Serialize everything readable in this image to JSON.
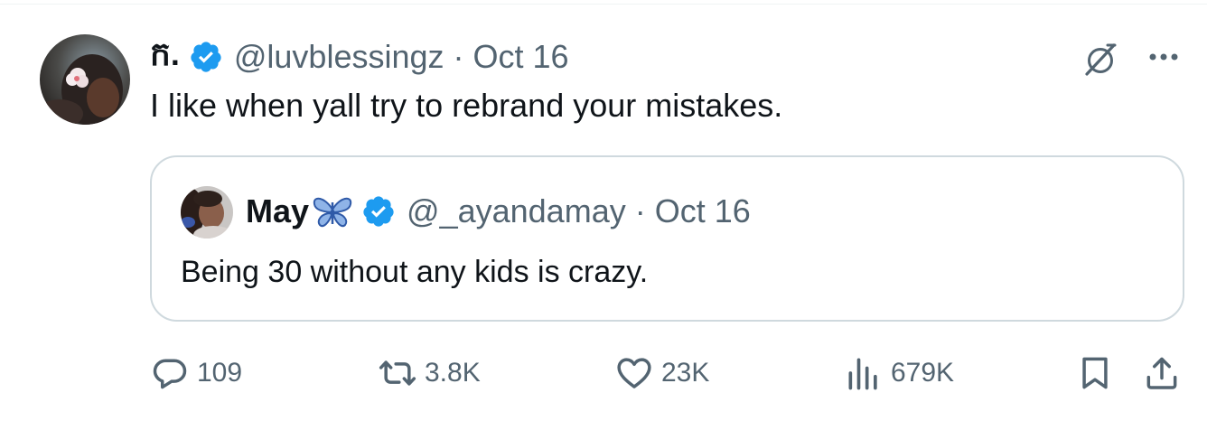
{
  "tweet": {
    "author_name": "ក.",
    "handle": "@luvblessingz",
    "separator": "·",
    "date": "Oct 16",
    "text": "I like when yall try to rebrand your mistakes."
  },
  "quoted": {
    "author_name": "May",
    "handle": "@_ayandamay",
    "separator": "·",
    "date": "Oct 16",
    "text": "Being 30 without any kids is crazy."
  },
  "actions": {
    "replies": "109",
    "reposts": "3.8K",
    "likes": "23K",
    "views": "679K"
  },
  "icons": {
    "verified": "verified-badge-icon",
    "grok": "grok-icon",
    "more": "more-icon",
    "reply": "reply-icon",
    "repost": "repost-icon",
    "like": "heart-icon",
    "views": "views-icon",
    "bookmark": "bookmark-icon",
    "share": "share-icon",
    "butterfly": "butterfly-icon"
  },
  "colors": {
    "text_primary": "#0f1419",
    "text_secondary": "#536471",
    "verified_blue": "#1d9bf0",
    "border": "#cfd9de",
    "butterfly_blue": "#5b8fd6"
  }
}
